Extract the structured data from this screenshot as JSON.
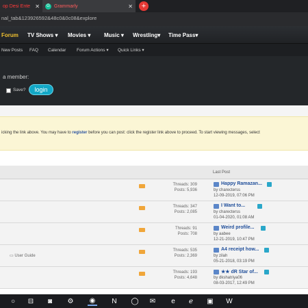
{
  "browser": {
    "tabs": [
      {
        "label": "op Desi Ente"
      },
      {
        "label": "Grammarly"
      }
    ],
    "new_tab": "+",
    "url": "nal_tab&123926592&48c0&0c08&explore"
  },
  "nav": {
    "items": [
      "Forum",
      "TV Shows ▾",
      "Movies ▾",
      "Music ▾",
      "Wrestling▾",
      "Time Pass▾"
    ],
    "subitems": [
      "New Posts",
      "FAQ",
      "Calendar",
      "Forum Actions ▾",
      "Quick Links ▾"
    ]
  },
  "login": {
    "member_text": "a member:",
    "save_label": "Save?",
    "login_button": "login"
  },
  "notice": {
    "text_before": "icking the link above. You may have to ",
    "register_link": "register",
    "text_after": " before you can post: click the register link above to proceed. To start viewing messages, select"
  },
  "table": {
    "last_post_header": "Last Post",
    "rows": [
      {
        "threads": "Threads: 309",
        "posts": "Posts: 5,936",
        "title": "Happy Ramazan...",
        "by": "by charecterss",
        "date": "12-09-2019, 07:06 PM",
        "sub": ""
      },
      {
        "threads": "Threads: 347",
        "posts": "Posts: 2,085",
        "title": "I Want to...",
        "by": "by charecterss",
        "date": "01-04-2020, 01:08 AM",
        "sub": ""
      },
      {
        "threads": "Threads: 91",
        "posts": "Posts: 708",
        "title": "Weird profile...",
        "by": "by aabee",
        "date": "12-21-2019, 10:47 PM",
        "sub": ""
      },
      {
        "threads": "Threads: 535",
        "posts": "Posts: 2,369",
        "title": "A4 receipt how...",
        "by": "by zilah",
        "date": "05-21-2018, 03:19 PM",
        "sub": "User Guide"
      },
      {
        "threads": "Threads: 193",
        "posts": "Posts: 4,648",
        "title": "★★ dR Star of...",
        "by": "by dkshatriya06",
        "date": "08-03-2017, 12:49 PM",
        "sub": ""
      }
    ]
  },
  "taskbar": {
    "icons": [
      "search-icon",
      "cortana-icon",
      "task-view-icon",
      "camera-app-icon",
      "settings-app-icon",
      "chrome-icon",
      "netflix-icon",
      "circle-app-icon",
      "mail-icon",
      "edge-icon",
      "ie-icon",
      "paint-app-icon",
      "word-icon"
    ]
  },
  "colors": {
    "nav_active": "#f2c230",
    "login_button": "#12a7c6",
    "notice_bg": "#fbf6d5",
    "link": "#1f4e9a"
  }
}
